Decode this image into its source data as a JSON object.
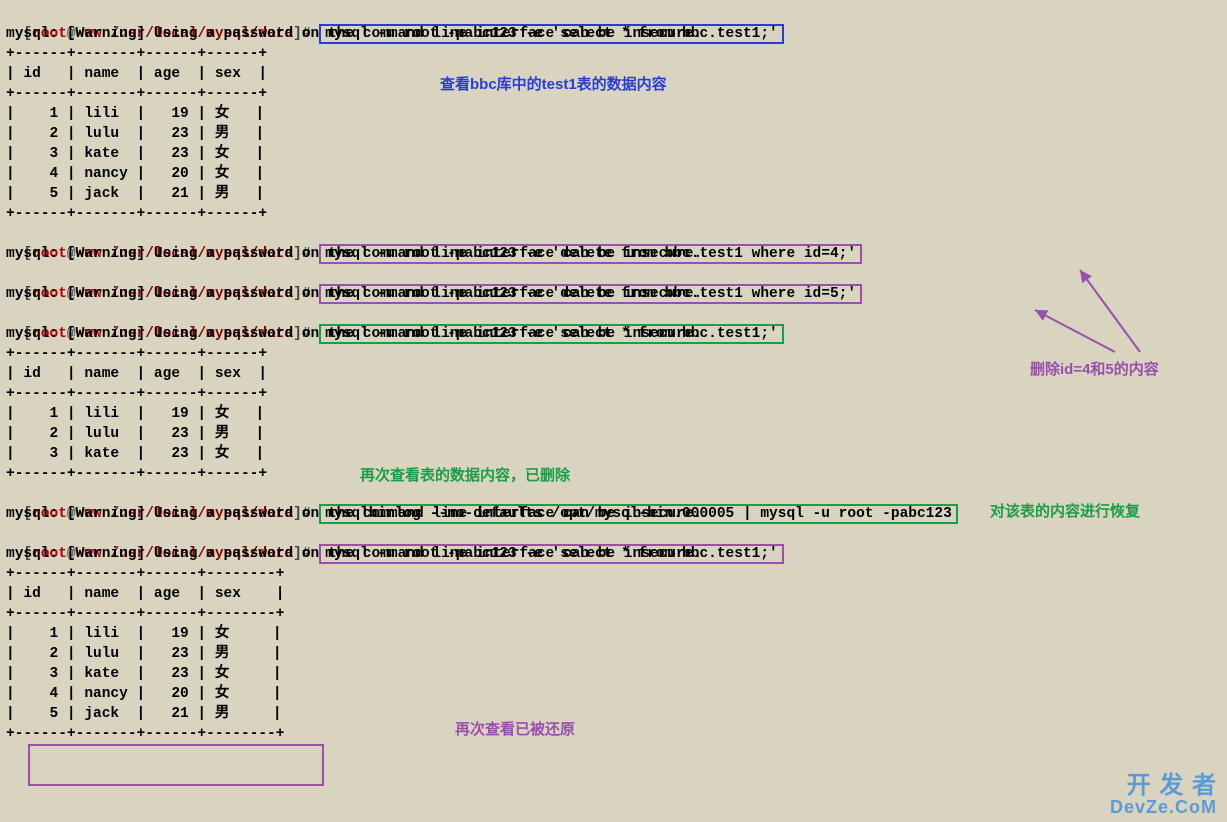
{
  "prompt": {
    "open": "[",
    "user": "root",
    "at": "@",
    "host": "www",
    "path": "/usr/local/mysql/data",
    "close": "]",
    "hash": "#"
  },
  "cmds": {
    "select1": "mysql -u root -pabc123 -e 'select * from bbc.test1;'",
    "del4": "mysql -u root -pabc123 -e 'delete from bbc.test1 where id=4;'",
    "del5": "mysql -u root -pabc123 -e 'delete from bbc.test1 where id=5;'",
    "select2": "mysql -u root -pabc123 -e 'select * from bbc.test1;'",
    "binlog": "mysqlbinlog --no-defaults /opt/mysql-bin.000005 | mysql -u root -pabc123",
    "select3": "mysql -u root -pabc123 -e 'select * from bbc.test1;'"
  },
  "warn": "mysql: [Warning] Using a password on the command line interface can be insecure.",
  "tbl": {
    "sep": "+------+-------+------+------+",
    "sepwide": "+------+-------+------+--------+",
    "hdr": "| id   | name  | age  | sex  |",
    "hdrwide": "| id   | name  | age  | sex    |",
    "r1": "|    1 | lili  |   19 | 女   |",
    "r2": "|    2 | lulu  |   23 | 男   |",
    "r3": "|    3 | kate  |   23 | 女   |",
    "r4": "|    4 | nancy |   20 | 女   |",
    "r5": "|    5 | jack  |   21 | 男   |",
    "r1w": "|    1 | lili  |   19 | 女     |",
    "r2w": "|    2 | lulu  |   23 | 男     |",
    "r3w": "|    3 | kate  |   23 | 女     |",
    "r4w": "|    4 | nancy |   20 | 女     |",
    "r5w": "|    5 | jack  |   21 | 男     |"
  },
  "ann": {
    "a1": "查看bbc库中的test1表的数据内容",
    "a2": "删除id=4和5的内容",
    "a3": "再次查看表的数据内容，已删除",
    "a4": "对该表的内容进行恢复",
    "a5": "再次查看已被还原"
  },
  "watermark": {
    "l1": "开 发 者",
    "l2": "DevZe.CoM"
  }
}
